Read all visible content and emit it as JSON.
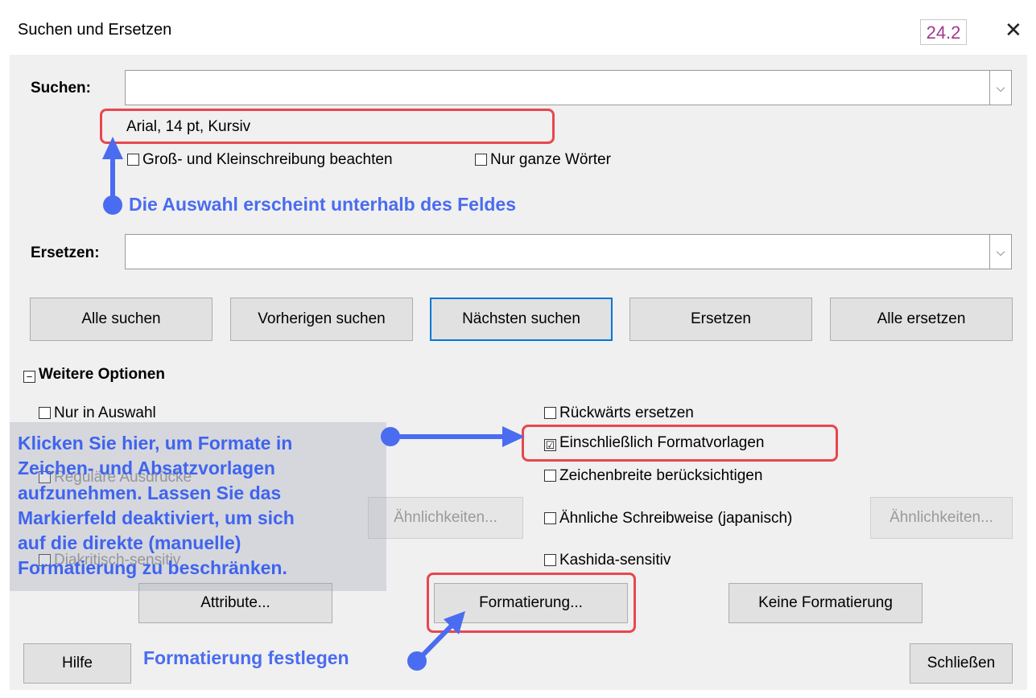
{
  "window": {
    "title": "Suchen und Ersetzen",
    "version_badge": "24.2",
    "close_glyph": "✕"
  },
  "search": {
    "label": "Suchen:",
    "value": "",
    "dropdown_glyph": "⌵",
    "format_summary": "Arial, 14 pt, Kursiv"
  },
  "options_top": {
    "match_case": {
      "label": "Groß- und Kleinschreibung beachten",
      "checked": false
    },
    "whole_words": {
      "label": "Nur ganze Wörter",
      "checked": false
    }
  },
  "replace": {
    "label": "Ersetzen:",
    "value": "",
    "dropdown_glyph": "⌵"
  },
  "buttons": {
    "find_all": "Alle suchen",
    "find_prev": "Vorherigen suchen",
    "find_next": "Nächsten suchen",
    "replace": "Ersetzen",
    "replace_all": "Alle ersetzen"
  },
  "more_options": {
    "toggle_glyph": "−",
    "label": "Weitere Optionen",
    "current_selection_only": "Nur in Auswahl",
    "regex": "Reguläre Ausdrücke",
    "diacritics": "Diakritisch-sensitiv",
    "similarities_left": "Ähnlichkeiten...",
    "replace_backwards": "Rückwärts ersetzen",
    "include_styles": "Einschließlich Formatvorlagen",
    "include_styles_check": "☑",
    "match_width": "Zeichenbreite berücksichtigen",
    "sounds_like": "Ähnliche Schreibweise (japanisch)",
    "similarities_right": "Ähnlichkeiten...",
    "kashida": "Kashida-sensitiv",
    "attributes": "Attribute...",
    "format": "Formatierung...",
    "no_format": "Keine Formatierung"
  },
  "footer": {
    "help": "Hilfe",
    "close": "Schließen"
  },
  "annotations": {
    "selection_note": "Die Auswahl erscheint unterhalb des Feldes",
    "styles_note_lines": [
      "Klicken Sie hier, um Formate in",
      "Zeichen- und Absatzvorlagen",
      "aufzunehmen. Lassen Sie das",
      "Markierfeld deaktiviert, um sich",
      "auf die direkte (manuelle)",
      "Formatierung zu beschränken."
    ],
    "format_note": "Formatierung festlegen",
    "accent_color": "#4a6cf0",
    "highlight_color": "#e8474e"
  }
}
